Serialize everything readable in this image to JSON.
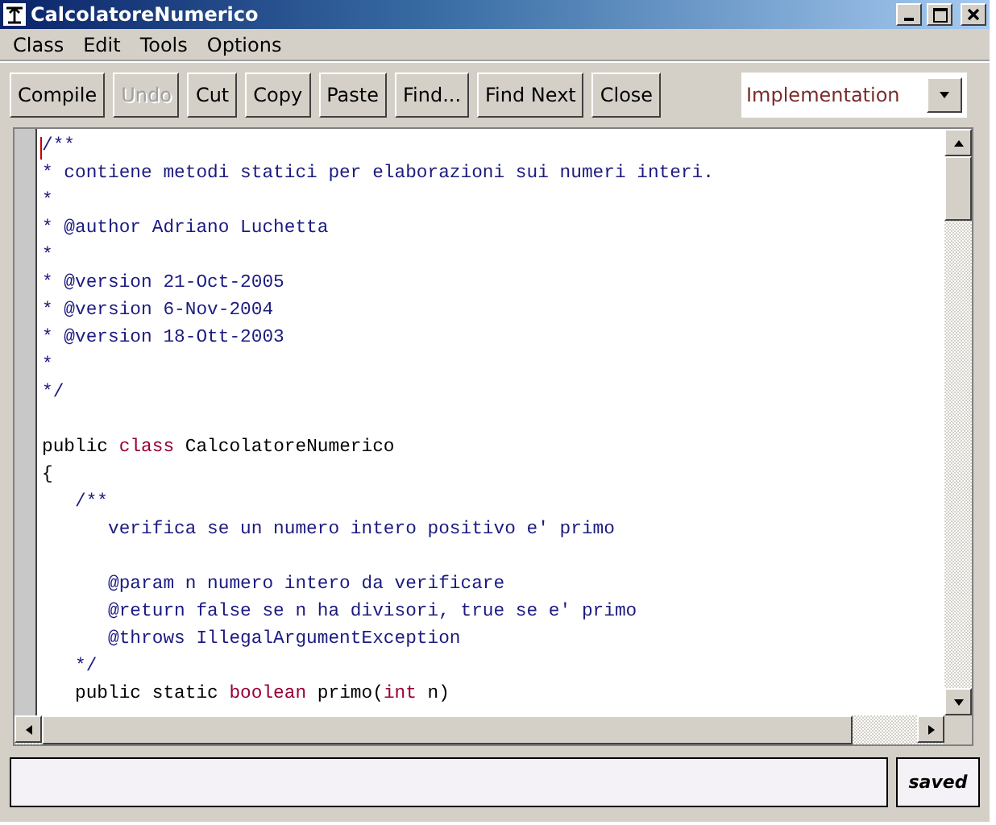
{
  "window": {
    "title": "CalcolatoreNumerico"
  },
  "menu": [
    "Class",
    "Edit",
    "Tools",
    "Options"
  ],
  "toolbar": [
    {
      "label": "Compile",
      "disabled": false
    },
    {
      "label": "Undo",
      "disabled": true
    },
    {
      "label": "Cut",
      "disabled": false
    },
    {
      "label": "Copy",
      "disabled": false
    },
    {
      "label": "Paste",
      "disabled": false
    },
    {
      "label": "Find...",
      "disabled": false
    },
    {
      "label": "Find Next",
      "disabled": false
    },
    {
      "label": "Close",
      "disabled": false
    }
  ],
  "view_select": {
    "value": "Implementation"
  },
  "editor": {
    "lines": [
      {
        "kind": "code",
        "segments": [
          {
            "text": "/**",
            "kind": "comment"
          }
        ]
      },
      {
        "kind": "code",
        "segments": [
          {
            "text": "* contiene metodi statici per elaborazioni sui numeri interi.",
            "kind": "comment"
          }
        ]
      },
      {
        "kind": "code",
        "segments": [
          {
            "text": "*",
            "kind": "comment"
          }
        ]
      },
      {
        "kind": "code",
        "segments": [
          {
            "text": "* @author Adriano Luchetta",
            "kind": "comment"
          }
        ]
      },
      {
        "kind": "code",
        "segments": [
          {
            "text": "*",
            "kind": "comment"
          }
        ]
      },
      {
        "kind": "code",
        "segments": [
          {
            "text": "* @version 21-Oct-2005",
            "kind": "comment"
          }
        ]
      },
      {
        "kind": "code",
        "segments": [
          {
            "text": "* @version 6-Nov-2004",
            "kind": "comment"
          }
        ]
      },
      {
        "kind": "code",
        "segments": [
          {
            "text": "* @version 18-Ott-2003",
            "kind": "comment"
          }
        ]
      },
      {
        "kind": "code",
        "segments": [
          {
            "text": "*",
            "kind": "comment"
          }
        ]
      },
      {
        "kind": "code",
        "segments": [
          {
            "text": "*/",
            "kind": "comment"
          }
        ]
      },
      {
        "kind": "blank"
      },
      {
        "kind": "code",
        "segments": [
          {
            "text": "public ",
            "kind": "plain"
          },
          {
            "text": "class",
            "kind": "keyword"
          },
          {
            "text": " CalcolatoreNumerico",
            "kind": "plain"
          }
        ]
      },
      {
        "kind": "code",
        "segments": [
          {
            "text": "{",
            "kind": "plain"
          }
        ]
      },
      {
        "kind": "code",
        "segments": [
          {
            "text": "   /**",
            "kind": "comment"
          }
        ]
      },
      {
        "kind": "code",
        "segments": [
          {
            "text": "      verifica se un numero intero positivo e' primo",
            "kind": "comment"
          }
        ]
      },
      {
        "kind": "blank"
      },
      {
        "kind": "code",
        "segments": [
          {
            "text": "      @param n numero intero da verificare",
            "kind": "comment"
          }
        ]
      },
      {
        "kind": "code",
        "segments": [
          {
            "text": "      @return false se n ha divisori, true se e' primo",
            "kind": "comment"
          }
        ]
      },
      {
        "kind": "code",
        "segments": [
          {
            "text": "      @throws IllegalArgumentException",
            "kind": "comment"
          }
        ]
      },
      {
        "kind": "code",
        "segments": [
          {
            "text": "   */",
            "kind": "comment"
          }
        ]
      },
      {
        "kind": "code",
        "segments": [
          {
            "text": "   public static ",
            "kind": "plain"
          },
          {
            "text": "boolean",
            "kind": "keyword"
          },
          {
            "text": " primo(",
            "kind": "plain"
          },
          {
            "text": "int",
            "kind": "keyword"
          },
          {
            "text": " n)",
            "kind": "plain"
          }
        ]
      }
    ]
  },
  "status": {
    "state": "saved"
  }
}
